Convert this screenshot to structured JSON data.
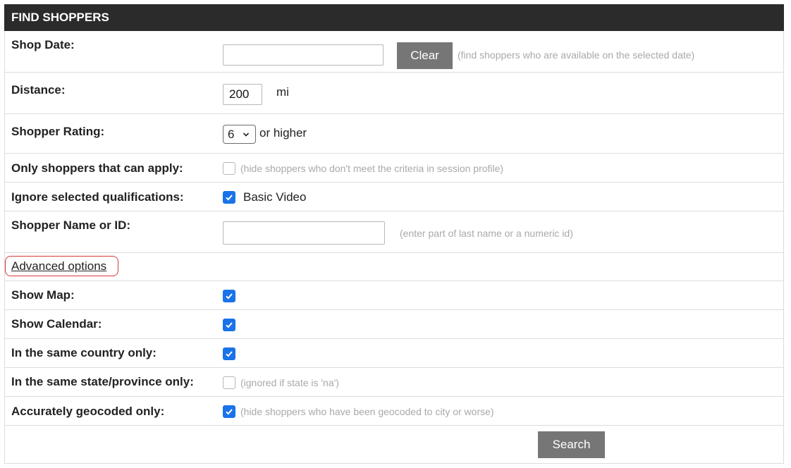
{
  "header": {
    "title": "FIND SHOPPERS"
  },
  "shop_date": {
    "label": "Shop Date:",
    "value": "",
    "clear_label": "Clear",
    "hint": "(find shoppers who are available on the selected date)"
  },
  "distance": {
    "label": "Distance:",
    "value": "200",
    "unit": "mi"
  },
  "rating": {
    "label": "Shopper Rating:",
    "selected": "6",
    "suffix": "or higher"
  },
  "can_apply": {
    "label": "Only shoppers that can apply:",
    "checked": false,
    "hint": "(hide shoppers who don't meet the criteria in session profile)"
  },
  "ignore_quals": {
    "label": "Ignore selected qualifications:",
    "checked": true,
    "option": "Basic Video"
  },
  "name_id": {
    "label": "Shopper Name or ID:",
    "value": "",
    "hint": "(enter part of last name or a numeric id)"
  },
  "advanced": {
    "link": "Advanced options"
  },
  "show_map": {
    "label": "Show Map:",
    "checked": true
  },
  "show_calendar": {
    "label": "Show Calendar:",
    "checked": true
  },
  "same_country": {
    "label": "In the same country only:",
    "checked": true
  },
  "same_state": {
    "label": "In the same state/province only:",
    "checked": false,
    "hint": "(ignored if state is 'na')"
  },
  "geocoded": {
    "label": "Accurately geocoded only:",
    "checked": true,
    "hint": "(hide shoppers who have been geocoded to city or worse)"
  },
  "search": {
    "label": "Search"
  },
  "colors": {
    "header_bg": "#2b2b2b",
    "checkbox_on": "#1a73e8",
    "button_bg": "#767676",
    "highlight": "#d33a3a"
  },
  "icons": {
    "checkmark": "checkmark-icon",
    "select_arrow": "chevron-down-icon"
  }
}
